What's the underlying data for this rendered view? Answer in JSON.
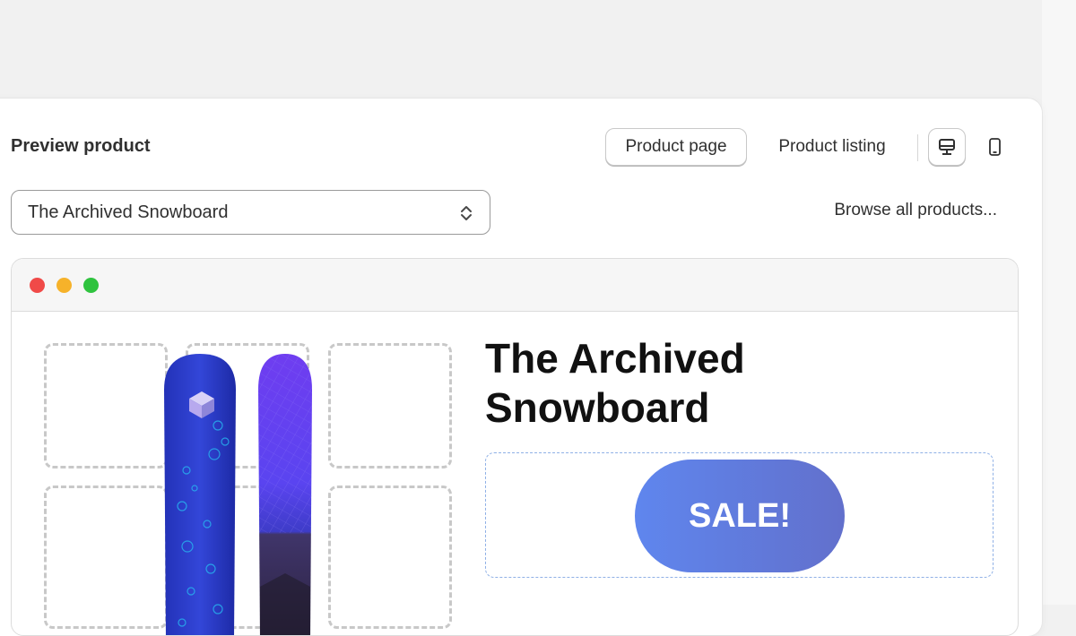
{
  "panel": {
    "title": "Preview product",
    "view_tabs": {
      "active_label": "Product page",
      "other_label": "Product listing"
    },
    "device_toggles": {
      "desktop_icon": "desktop-monitor-icon",
      "mobile_icon": "mobile-phone-icon"
    },
    "product_select": {
      "value": "The Archived Snowboard",
      "chevron_icon": "select-chevrons-icon"
    },
    "browse_link": "Browse all products..."
  },
  "preview": {
    "window_controls": [
      "red",
      "yellow",
      "green"
    ],
    "product_title": "The Archived Snowboard",
    "sale_badge": "SALE!",
    "colors": {
      "sale_gradient_start": "#5f86ee",
      "sale_gradient_end": "#6270cc",
      "board_blue": "#2f3fd0",
      "board_purple": "#7a3df2"
    }
  }
}
